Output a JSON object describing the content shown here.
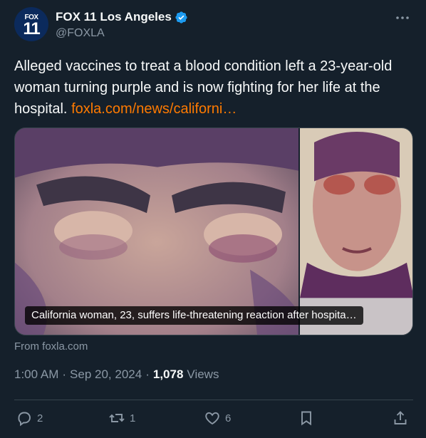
{
  "account": {
    "avatar_top": "FOX",
    "avatar_bottom": "11",
    "display_name": "FOX 11 Los Angeles",
    "handle": "@FOXLA",
    "verified": true
  },
  "tweet": {
    "text": "Alleged vaccines to treat a blood condition left a 23-year-old woman turning purple and is now fighting for her life at the hospital.",
    "link": "foxla.com/news/californi…"
  },
  "card": {
    "caption": "California woman, 23, suffers life-threatening reaction after hospita…",
    "source": "From foxla.com"
  },
  "meta": {
    "time": "1:00 AM",
    "sep1": "·",
    "date": "Sep 20, 2024",
    "sep2": "·",
    "views_count": "1,078",
    "views_label": "Views"
  },
  "actions": {
    "replies": "2",
    "reposts": "1",
    "likes": "6"
  },
  "colors": {
    "background": "#15202b",
    "link": "#ff7a00",
    "muted": "#8b98a5",
    "verified": "#1d9bf0"
  }
}
